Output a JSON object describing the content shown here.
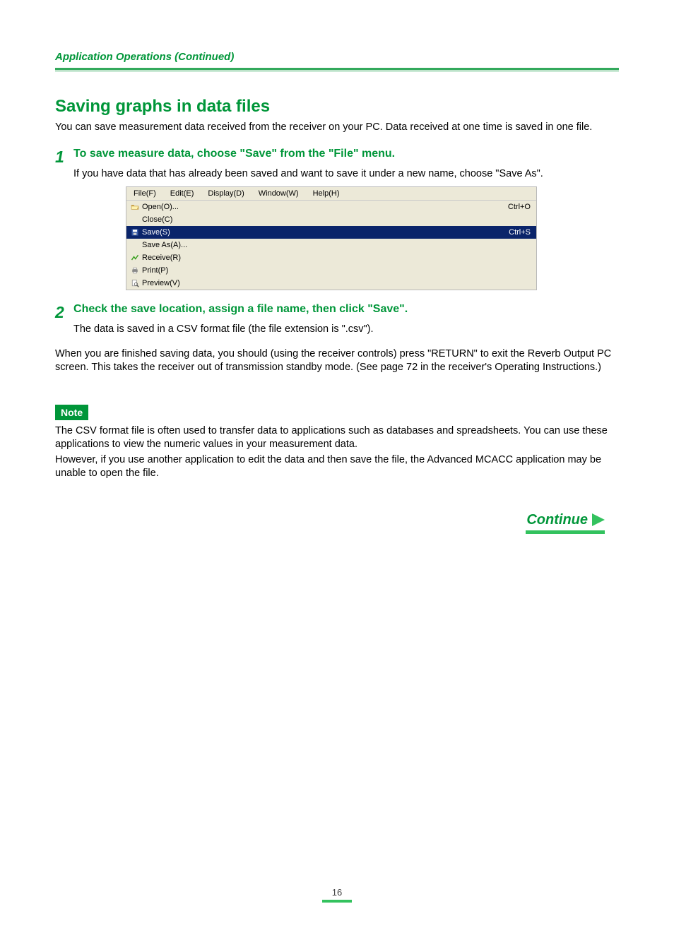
{
  "header": {
    "section": "Application Operations (Continued)"
  },
  "title": "Saving graphs in data files",
  "intro": "You can save measurement data received from the receiver on your PC. Data received at one time is saved in one file.",
  "step1": {
    "num": "1",
    "title": "To save measure data, choose \"Save\" from the \"File\" menu.",
    "body": "If you have data that has already been saved and want to save it under a new name, choose \"Save As\"."
  },
  "menu": {
    "bar": [
      "File(F)",
      "Edit(E)",
      "Display(D)",
      "Window(W)",
      "Help(H)"
    ],
    "items": [
      {
        "icon": "open",
        "label": "Open(O)...",
        "shortcut": "Ctrl+O",
        "selected": false
      },
      {
        "icon": "",
        "label": "Close(C)",
        "shortcut": "",
        "selected": false
      },
      {
        "icon": "save",
        "label": "Save(S)",
        "shortcut": "Ctrl+S",
        "selected": true
      },
      {
        "icon": "",
        "label": "Save As(A)...",
        "shortcut": "",
        "selected": false
      },
      {
        "icon": "receive",
        "label": "Receive(R)",
        "shortcut": "",
        "selected": false
      },
      {
        "icon": "print",
        "label": "Print(P)",
        "shortcut": "",
        "selected": false
      },
      {
        "icon": "preview",
        "label": "Preview(V)",
        "shortcut": "",
        "selected": false
      }
    ]
  },
  "step2": {
    "num": "2",
    "title": "Check the save location, assign a file name, then click \"Save\".",
    "body": "The data is saved in a CSV format file (the file extension is \".csv\")."
  },
  "after_steps": "When you are finished saving data, you should (using the receiver controls) press \"RETURN\" to exit the Reverb Output PC screen. This takes the receiver out of transmission standby mode. (See page 72 in the receiver's Operating Instructions.)",
  "note": {
    "badge": "Note",
    "p1": "The CSV format file is often used to transfer data to applications such as databases and spreadsheets. You can use these applications to view the numeric values in your measurement data.",
    "p2": "However, if you use another application to edit the data and then save the file, the Advanced MCACC application may be unable to open the file."
  },
  "continue": "Continue",
  "page_number": "16"
}
